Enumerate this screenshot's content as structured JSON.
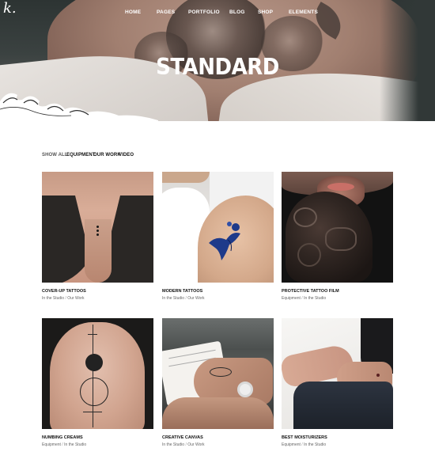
{
  "logo": {
    "text": "k."
  },
  "nav": [
    "HOME",
    "PAGES",
    "PORTFOLIO",
    "BLOG",
    "SHOP",
    "ELEMENTS"
  ],
  "hero": {
    "title": "STANDARD"
  },
  "filters": [
    "SHOW ALL",
    "EQUIPMENT",
    "OUR WORK",
    "VIDEO"
  ],
  "portfolio": [
    {
      "title": "COVER-UP TATTOOS",
      "cat1": "In the Studio",
      "cat2": "Our Work"
    },
    {
      "title": "MODERN TATTOOS",
      "cat1": "In the Studio",
      "cat2": "Our Work"
    },
    {
      "title": "PROTECTIVE TATTOO FILM",
      "cat1": "Equipment",
      "cat2": "In the Studio"
    },
    {
      "title": "NUMBING CREAMS",
      "cat1": "Equipment",
      "cat2": "In the Studio"
    },
    {
      "title": "CREATIVE CANVAS",
      "cat1": "In the Studio",
      "cat2": "Our Work"
    },
    {
      "title": "BEST MOISTURIZERS",
      "cat1": "Equipment",
      "cat2": "In the Studio"
    }
  ],
  "separator": "/",
  "icons": [
    "wave-ornament-icon"
  ]
}
